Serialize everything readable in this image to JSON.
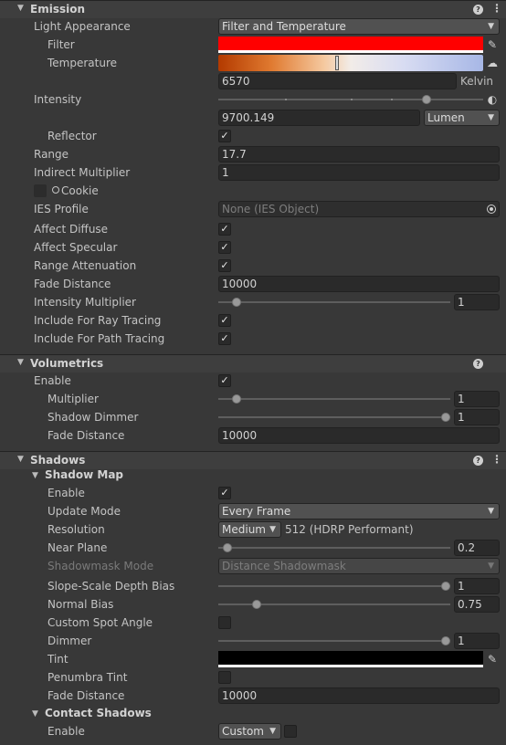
{
  "emission": {
    "title": "Emission",
    "light_appearance": {
      "label": "Light Appearance",
      "value": "Filter and Temperature"
    },
    "filter": {
      "label": "Filter",
      "color": "#ff0000"
    },
    "temperature": {
      "label": "Temperature",
      "value": "6570",
      "unit": "Kelvin"
    },
    "intensity": {
      "label": "Intensity",
      "value": "9700.149",
      "unit": "Lumen",
      "slider": 0.8
    },
    "reflector": {
      "label": "Reflector",
      "checked": true
    },
    "range": {
      "label": "Range",
      "value": "17.7"
    },
    "indirect_multiplier": {
      "label": "Indirect Multiplier",
      "value": "1"
    },
    "cookie": {
      "label": "Cookie"
    },
    "ies_profile": {
      "label": "IES Profile",
      "value": "None (IES Object)"
    },
    "affect_diffuse": {
      "label": "Affect Diffuse",
      "checked": true
    },
    "affect_specular": {
      "label": "Affect Specular",
      "checked": true
    },
    "range_attenuation": {
      "label": "Range Attenuation",
      "checked": true
    },
    "fade_distance": {
      "label": "Fade Distance",
      "value": "10000"
    },
    "intensity_multiplier": {
      "label": "Intensity Multiplier",
      "value": "1",
      "slider": 0.08
    },
    "include_ray_tracing": {
      "label": "Include For Ray Tracing",
      "checked": true
    },
    "include_path_tracing": {
      "label": "Include For Path Tracing",
      "checked": true
    }
  },
  "volumetrics": {
    "title": "Volumetrics",
    "enable": {
      "label": "Enable",
      "checked": true
    },
    "multiplier": {
      "label": "Multiplier",
      "value": "1",
      "slider": 0.08
    },
    "shadow_dimmer": {
      "label": "Shadow Dimmer",
      "value": "1",
      "slider": 1.0
    },
    "fade_distance": {
      "label": "Fade Distance",
      "value": "10000"
    }
  },
  "shadows": {
    "title": "Shadows",
    "shadow_map": {
      "title": "Shadow Map",
      "enable": {
        "label": "Enable",
        "checked": true
      },
      "update_mode": {
        "label": "Update Mode",
        "value": "Every Frame"
      },
      "resolution": {
        "label": "Resolution",
        "value": "Medium",
        "note": "512 (HDRP Performant)"
      },
      "near_plane": {
        "label": "Near Plane",
        "value": "0.2",
        "slider": 0.03
      },
      "shadowmask_mode": {
        "label": "Shadowmask Mode",
        "value": "Distance Shadowmask"
      },
      "slope_scale_depth_bias": {
        "label": "Slope-Scale Depth Bias",
        "value": "1",
        "slider": 1.0
      },
      "normal_bias": {
        "label": "Normal Bias",
        "value": "0.75",
        "slider": 0.17
      },
      "custom_spot_angle": {
        "label": "Custom Spot Angle",
        "checked": false
      },
      "dimmer": {
        "label": "Dimmer",
        "value": "1",
        "slider": 1.0
      },
      "tint": {
        "label": "Tint",
        "color": "#000000"
      },
      "penumbra_tint": {
        "label": "Penumbra Tint",
        "checked": false
      },
      "fade_distance": {
        "label": "Fade Distance",
        "value": "10000"
      }
    },
    "contact_shadows": {
      "title": "Contact Shadows",
      "enable": {
        "label": "Enable",
        "value": "Custom",
        "checked": false
      }
    }
  }
}
